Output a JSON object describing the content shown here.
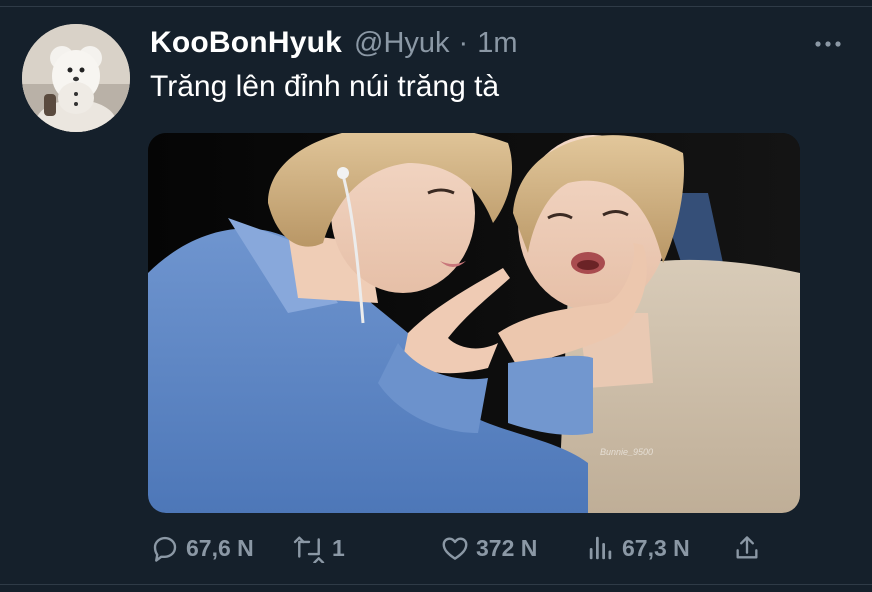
{
  "tweet": {
    "display_name": "KooBonHyuk",
    "handle": "@Hyuk",
    "separator": "·",
    "time": "1m",
    "text": "Trăng lên đỉnh núi trăng tà",
    "media_watermark": "Bunnie_9500"
  },
  "actions": {
    "reply_count": "67,6 N",
    "retweet_count": "1",
    "like_count": "372 N",
    "views_count": "67,3 N"
  },
  "icons": {
    "more": "more-horizontal-icon",
    "reply": "reply-icon",
    "retweet": "retweet-icon",
    "like": "heart-icon",
    "views": "analytics-icon",
    "share": "share-icon"
  },
  "colors": {
    "background": "#15202b",
    "primary_text": "#ffffff",
    "secondary_text": "#8b98a5",
    "divider": "#2f3b47"
  }
}
